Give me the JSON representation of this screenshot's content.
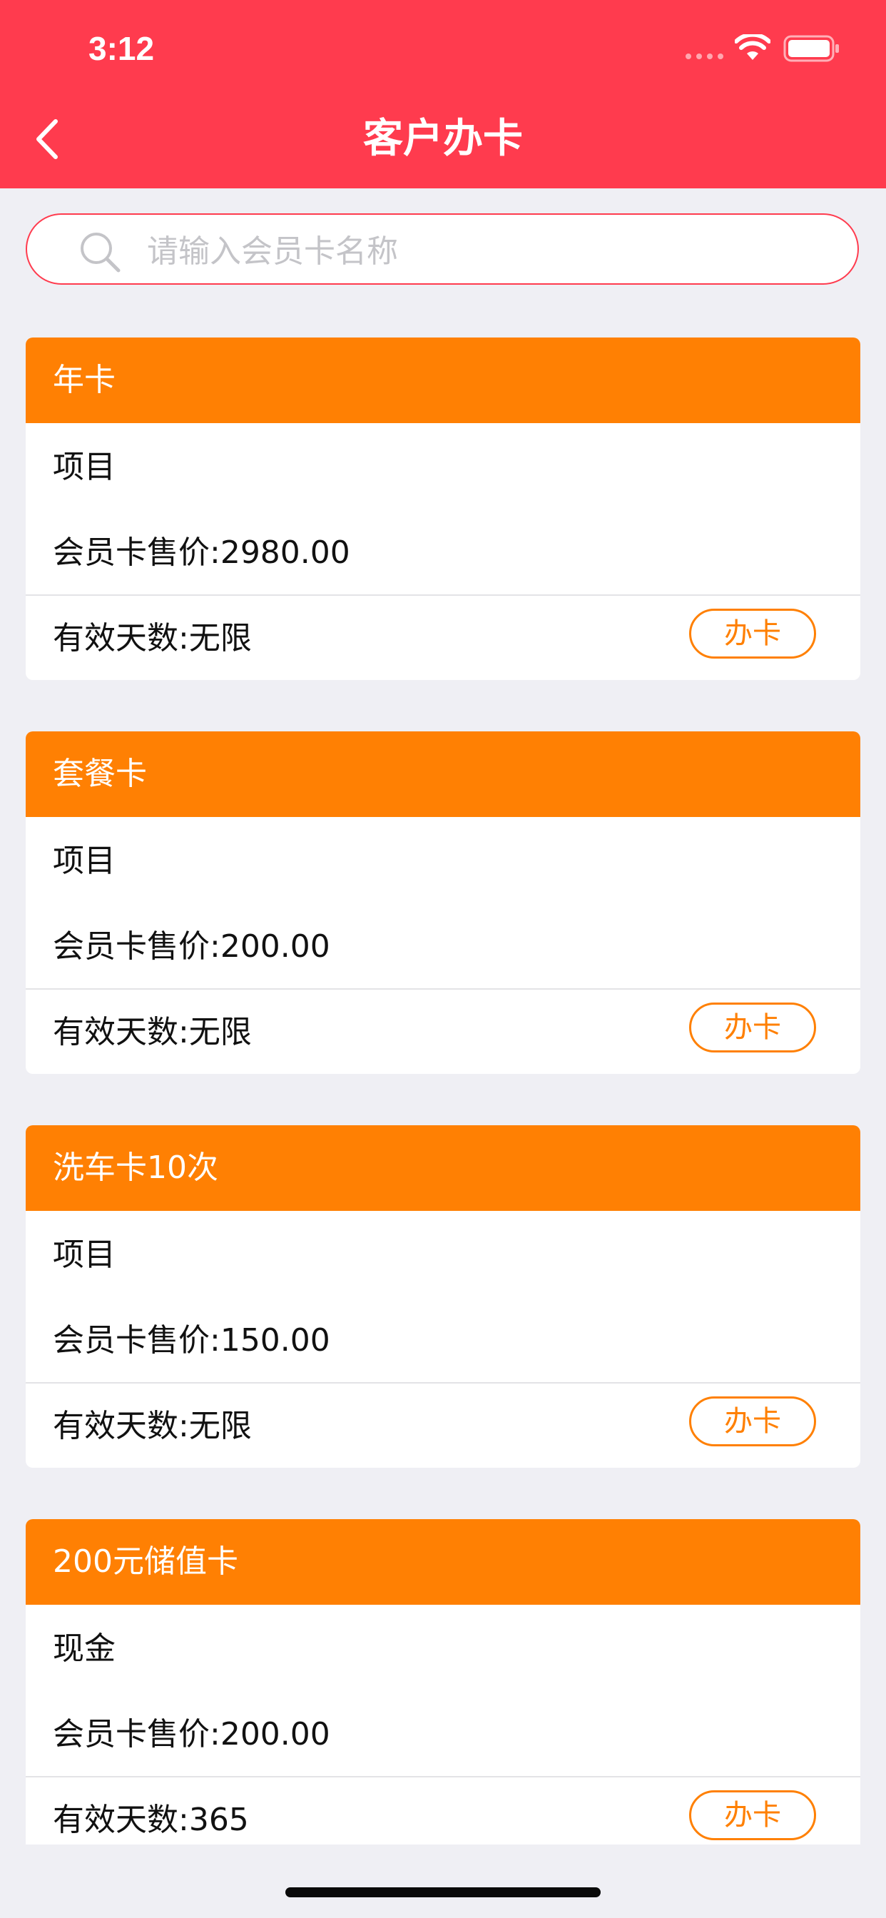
{
  "status_bar": {
    "time": "3:12"
  },
  "nav": {
    "title": "客户办卡",
    "back_icon": "chevron-left-icon"
  },
  "search": {
    "placeholder": "请输入会员卡名称",
    "value": "",
    "icon": "search-icon"
  },
  "colors": {
    "header": "#ff3b4e",
    "accent": "#ff8003",
    "background": "#efeff4"
  },
  "cards": [
    {
      "name": "年卡",
      "type": "项目",
      "price": "会员卡售价:2980.00",
      "days": "有效天数:无限",
      "button": "办卡"
    },
    {
      "name": "套餐卡",
      "type": "项目",
      "price": "会员卡售价:200.00",
      "days": "有效天数:无限",
      "button": "办卡"
    },
    {
      "name": "洗车卡10次",
      "type": "项目",
      "price": "会员卡售价:150.00",
      "days": "有效天数:无限",
      "button": "办卡"
    },
    {
      "name": "200元储值卡",
      "type": "现金",
      "price": "会员卡售价:200.00",
      "days": "有效天数:365",
      "button": "办卡"
    }
  ]
}
